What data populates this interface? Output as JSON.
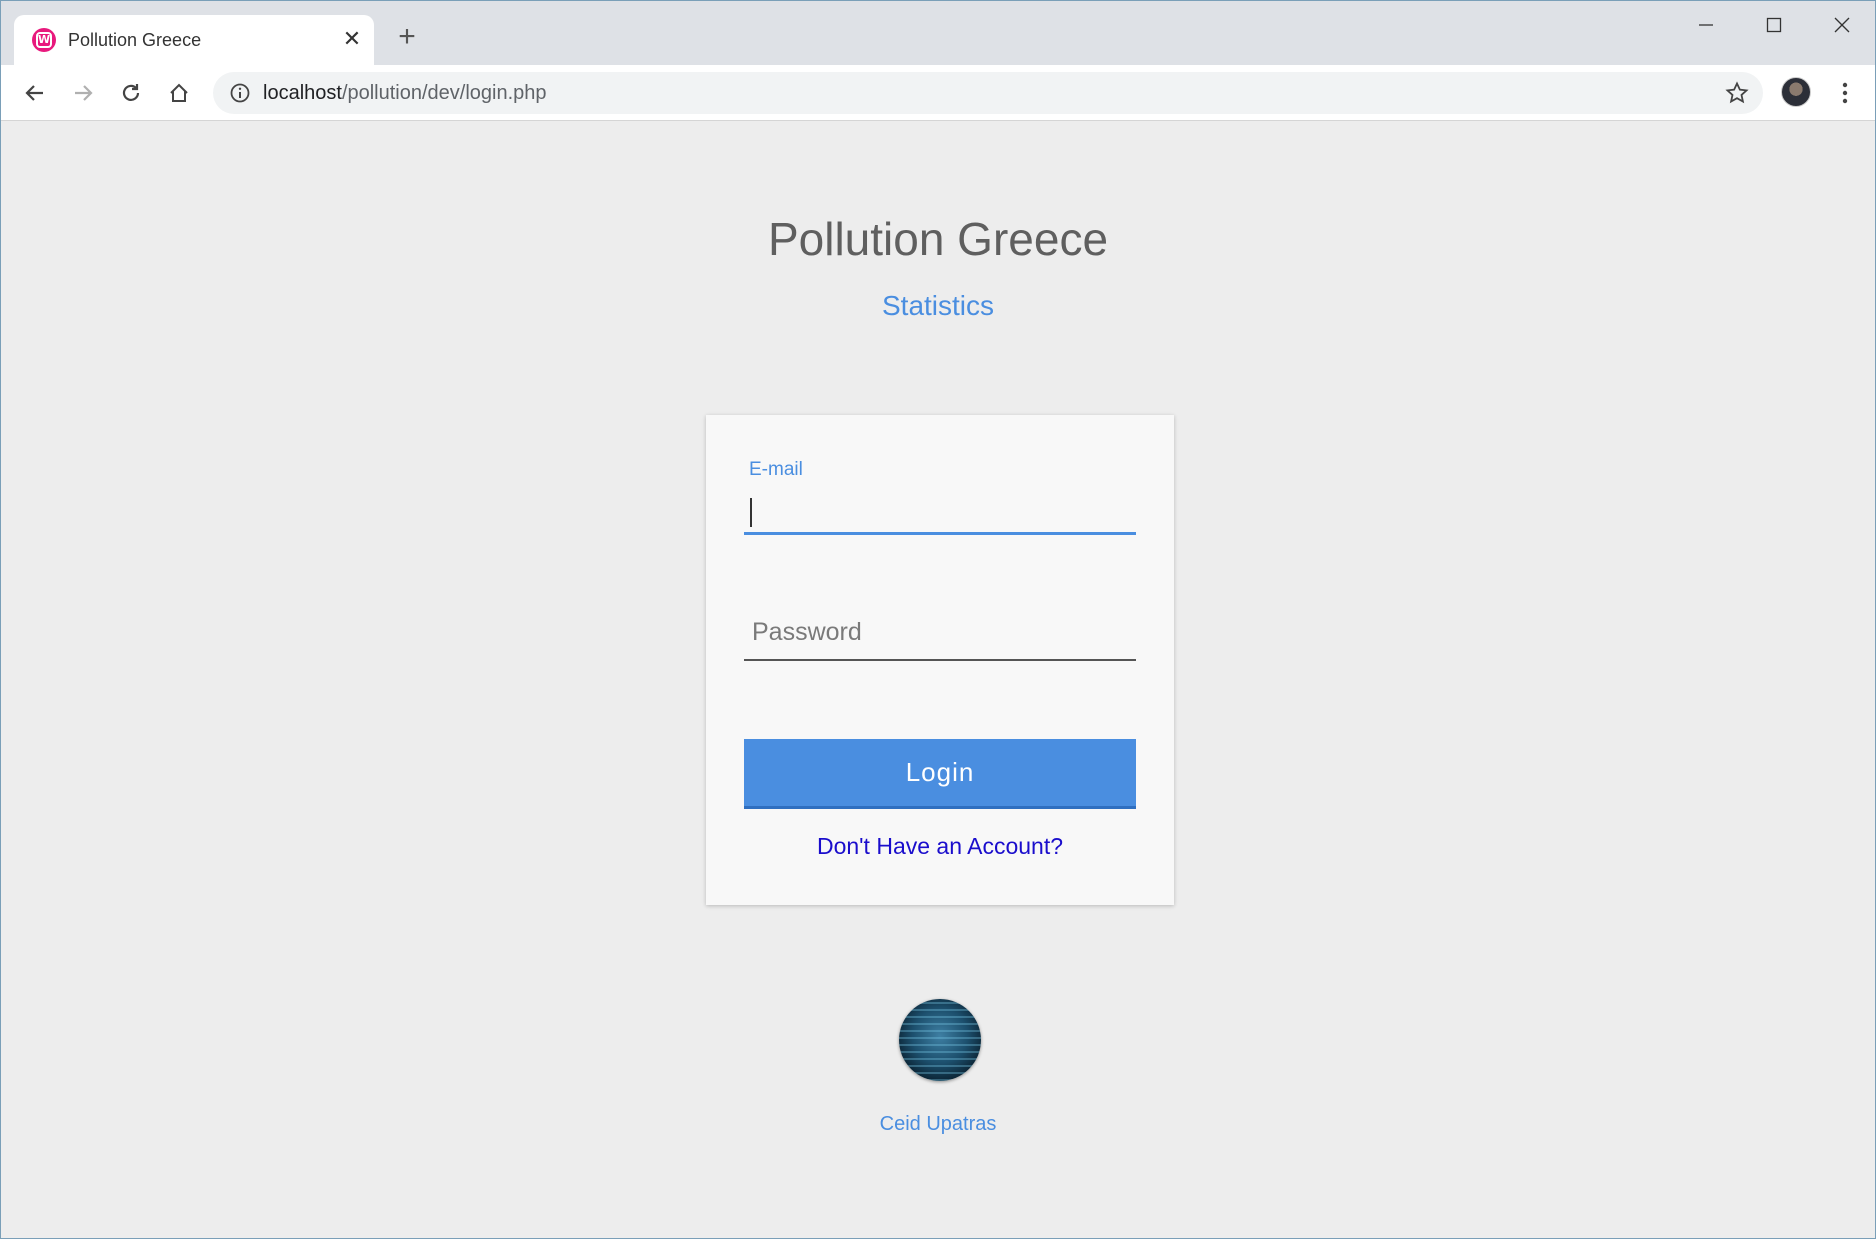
{
  "browser": {
    "tab_title": "Pollution Greece",
    "url_host": "localhost",
    "url_path": "/pollution/dev/login.php",
    "favicon_letter": "W"
  },
  "page": {
    "title": "Pollution Greece",
    "subtitle": "Statistics"
  },
  "login_form": {
    "email_label": "E-mail",
    "email_value": "",
    "password_placeholder": "Password",
    "login_label": "Login",
    "signup_link": "Don't Have an Account?"
  },
  "footer": {
    "text": "Ceid Upatras",
    "logo_icon": "globe-logo-icon"
  },
  "colors": {
    "accent": "#4a8ee0",
    "link": "#1a0dcc",
    "title": "#5f5f5f",
    "background": "#ededed",
    "card": "#f8f8f8"
  }
}
